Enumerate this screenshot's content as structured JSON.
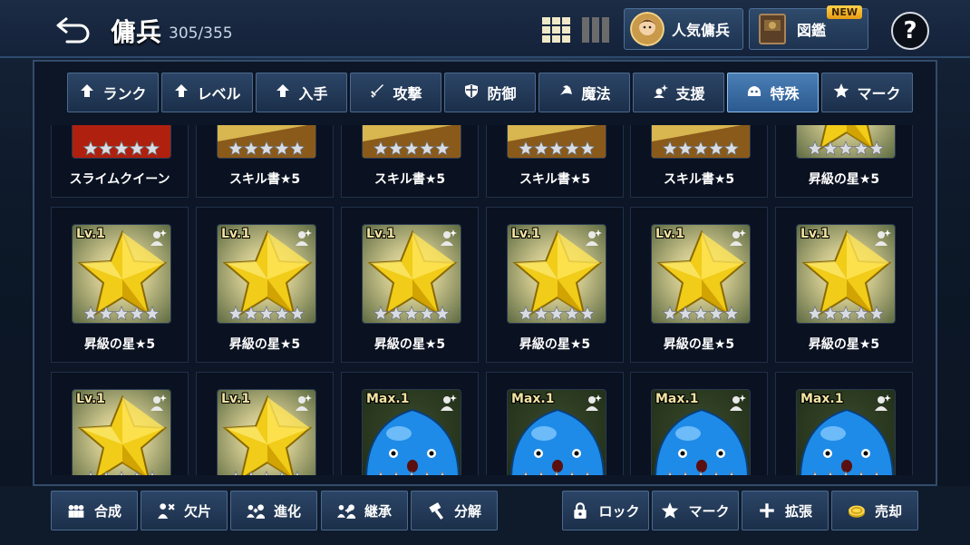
{
  "header": {
    "title": "傭兵",
    "count": "305/355",
    "popular_label": "人気傭兵",
    "dex_label": "図鑑",
    "new_badge": "NEW",
    "help_label": "?"
  },
  "tabs": [
    {
      "label": "ランク",
      "icon": "up-arrow-icon",
      "active": false
    },
    {
      "label": "レベル",
      "icon": "up-arrow-icon",
      "active": false
    },
    {
      "label": "入手",
      "icon": "up-arrow-icon",
      "active": false
    },
    {
      "label": "攻撃",
      "icon": "sword-icon",
      "active": false
    },
    {
      "label": "防御",
      "icon": "shield-icon",
      "active": false
    },
    {
      "label": "魔法",
      "icon": "magic-hat-icon",
      "active": false
    },
    {
      "label": "支援",
      "icon": "support-icon",
      "active": false
    },
    {
      "label": "特殊",
      "icon": "slime-icon",
      "active": true
    },
    {
      "label": "マーク",
      "icon": "star-icon",
      "active": false
    }
  ],
  "grid": {
    "rows": [
      [
        {
          "name": "スライムクイーン",
          "type": "queen"
        },
        {
          "name": "スキル書★5",
          "type": "book"
        },
        {
          "name": "スキル書★5",
          "type": "book"
        },
        {
          "name": "スキル書★5",
          "type": "book"
        },
        {
          "name": "スキル書★5",
          "type": "book"
        },
        {
          "name": "昇級の星★5",
          "type": "star"
        }
      ],
      [
        {
          "name": "昇級の星★5",
          "type": "star",
          "level": "Lv.1"
        },
        {
          "name": "昇級の星★5",
          "type": "star",
          "level": "Lv.1"
        },
        {
          "name": "昇級の星★5",
          "type": "star",
          "level": "Lv.1"
        },
        {
          "name": "昇級の星★5",
          "type": "star",
          "level": "Lv.1"
        },
        {
          "name": "昇級の星★5",
          "type": "star",
          "level": "Lv.1"
        },
        {
          "name": "昇級の星★5",
          "type": "star",
          "level": "Lv.1"
        }
      ],
      [
        {
          "name": "",
          "type": "star",
          "level": "Lv.1"
        },
        {
          "name": "",
          "type": "star",
          "level": "Lv.1"
        },
        {
          "name": "",
          "type": "slime",
          "level": "Max.1"
        },
        {
          "name": "",
          "type": "slime",
          "level": "Max.1"
        },
        {
          "name": "",
          "type": "slime",
          "level": "Max.1"
        },
        {
          "name": "",
          "type": "slime",
          "level": "Max.1"
        }
      ]
    ]
  },
  "bottom_left": [
    {
      "label": "合成",
      "icon": "fusion-icon"
    },
    {
      "label": "欠片",
      "icon": "shard-icon"
    },
    {
      "label": "進化",
      "icon": "evolve-icon"
    },
    {
      "label": "継承",
      "icon": "inherit-icon"
    },
    {
      "label": "分解",
      "icon": "hammer-icon"
    }
  ],
  "bottom_right": [
    {
      "label": "ロック",
      "icon": "lock-icon"
    },
    {
      "label": "マーク",
      "icon": "star-icon"
    },
    {
      "label": "拡張",
      "icon": "plus-icon"
    },
    {
      "label": "売却",
      "icon": "coin-icon"
    }
  ],
  "colors": {
    "accent": "#4a7fb6",
    "gold": "#f5c400",
    "slime": "#1f7fe0"
  }
}
